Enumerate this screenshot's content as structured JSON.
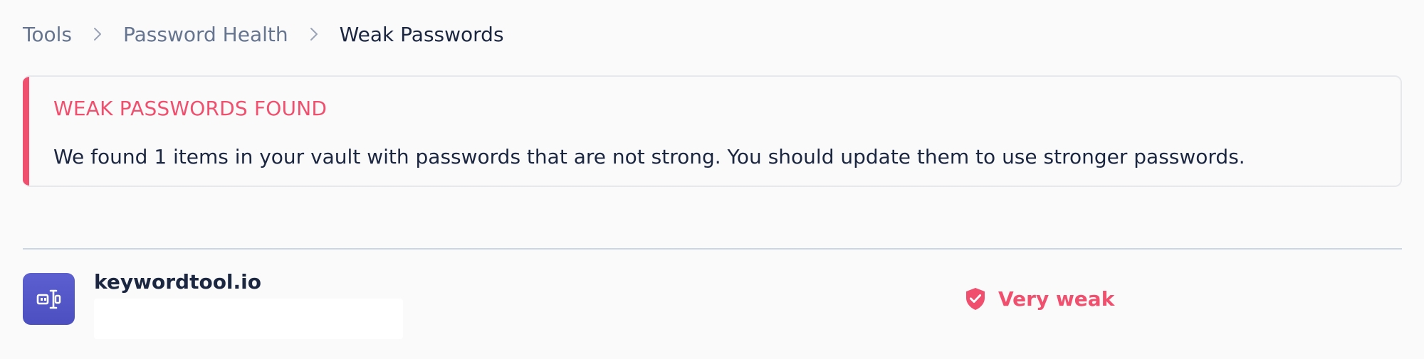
{
  "breadcrumb": {
    "items": [
      {
        "label": "Tools"
      },
      {
        "label": "Password Health"
      },
      {
        "label": "Weak Passwords"
      }
    ],
    "separator_icon": "chevron-right-icon"
  },
  "alert": {
    "title": "WEAK PASSWORDS FOUND",
    "message": "We found 1 items in your vault with passwords that are not strong. You should update them to use stronger passwords.",
    "accent_color": "#f0506e"
  },
  "items": [
    {
      "name": "keywordtool.io",
      "icon": "keywordtool-logo-icon",
      "strength_label": "Very weak",
      "strength_icon": "shield-check-icon",
      "strength_color": "#f0506e"
    }
  ]
}
